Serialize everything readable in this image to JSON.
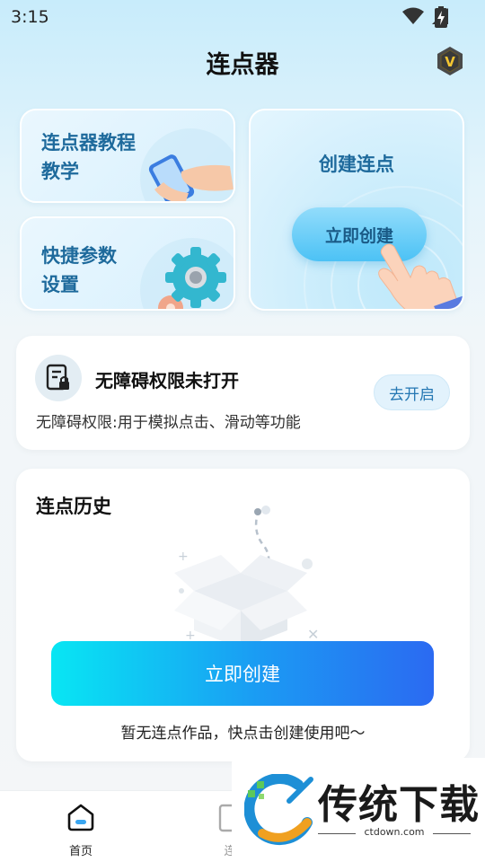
{
  "status_bar": {
    "time": "3:15",
    "icons": [
      "wifi-icon",
      "signal-icon",
      "battery-icon"
    ]
  },
  "header": {
    "title": "连点器",
    "badge_letter": "V"
  },
  "tools": {
    "tutorial": {
      "line1": "连点器教程",
      "line2": "教学"
    },
    "params": {
      "line1": "快捷参数",
      "line2": "设置"
    },
    "create": {
      "title": "创建连点",
      "button": "立即创建"
    }
  },
  "permission": {
    "title": "无障碍权限未打开",
    "description": "无障碍权限:用于模拟点击、滑动等功能",
    "button": "去开启"
  },
  "history": {
    "title": "连点历史",
    "create_button": "立即创建",
    "empty_text": "暂无连点作品，快点击创建使用吧～"
  },
  "bottom_nav": [
    {
      "label": "首页",
      "icon": "home-icon",
      "active": true
    },
    {
      "label": "连",
      "icon": "history-icon",
      "active": false
    }
  ],
  "watermark": {
    "text": "传统下载",
    "url": "ctdown.com"
  },
  "colors": {
    "accent": "#1e6a9c",
    "gradient_start": "#08e6f3",
    "gradient_end": "#2b6af2"
  }
}
